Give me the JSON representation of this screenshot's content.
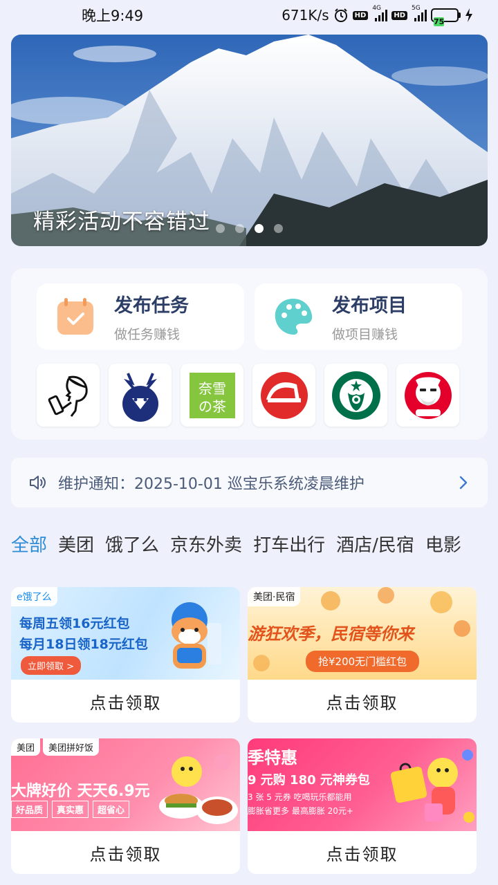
{
  "status_bar": {
    "time": "晚上9:49",
    "network_speed": "671K/s",
    "hd1": "HD",
    "sig1_label": "4G",
    "hd2": "HD",
    "sig2_label": "5G",
    "battery": "75"
  },
  "banner": {
    "caption": "精彩活动不容错过",
    "pages": 4,
    "active_page": 3
  },
  "actions": [
    {
      "title": "发布任务",
      "subtitle": "做任务赚钱",
      "icon": "calendar-check-icon"
    },
    {
      "title": "发布项目",
      "subtitle": "做项目赚钱",
      "icon": "palette-icon"
    }
  ],
  "brands": [
    {
      "name": "drinking-figure-logo"
    },
    {
      "name": "deer-logo"
    },
    {
      "name": "nayuki-logo",
      "text": "奈雪の茶"
    },
    {
      "name": "pizza-hut-logo"
    },
    {
      "name": "starbucks-logo"
    },
    {
      "name": "kfc-logo"
    }
  ],
  "notice": {
    "text": "维护通知：2025-10-01 巡宝乐系统凌晨维护"
  },
  "tabs": [
    "全部",
    "美团",
    "饿了么",
    "京东外卖",
    "打车出行",
    "酒店/民宿",
    "电影"
  ],
  "coupons": [
    {
      "tag": "e饿了么",
      "line1": "每周五领16元红包",
      "line2": "每月18日领18元红包",
      "button": "立即领取 >",
      "cta": "点击领取"
    },
    {
      "tag": "美团·民宿",
      "line1": "游狂欢季，民宿等你来",
      "button": "抢¥200无门槛红包",
      "cta": "点击领取"
    },
    {
      "tag": "美团",
      "tag2": "美团拼好饭",
      "line1": "大牌好价 天天6.9元",
      "chips": [
        "好品质",
        "真实惠",
        "超省心"
      ],
      "cta": "点击领取"
    },
    {
      "line1": "季特惠",
      "line2": "9 元购 180 元神券包",
      "line3": "3 张 5 元券  吃喝玩乐都能用",
      "line4": "膨胀省更多  最高膨胀 20元+",
      "cta": "点击领取"
    }
  ],
  "colors": {
    "accent": "#2e8bd6",
    "background": "#eef1fb",
    "title_text": "#2c3e66"
  }
}
